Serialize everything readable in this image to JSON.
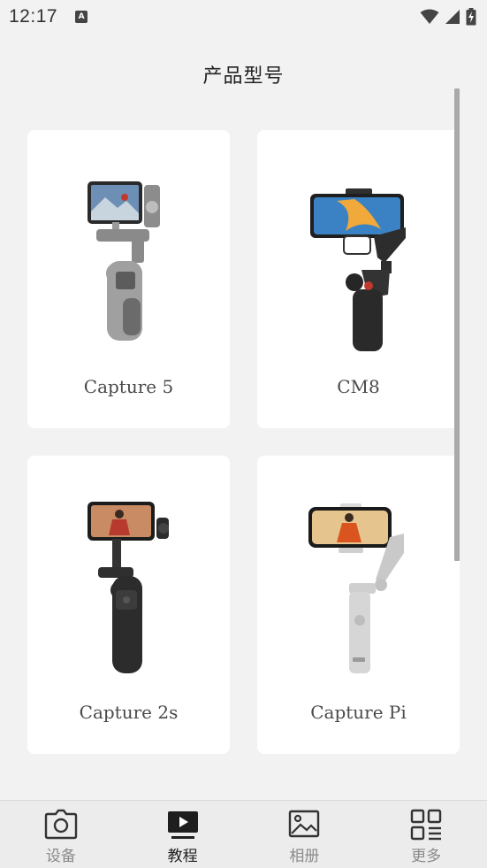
{
  "status_bar": {
    "time": "12:17",
    "notification_letter": "A"
  },
  "header": {
    "title": "产品型号"
  },
  "products": [
    {
      "name": "Capture 5",
      "image": "gimbal-grey-phone-landscape"
    },
    {
      "name": "CM8",
      "image": "gimbal-black-foldable"
    },
    {
      "name": "Capture 2s",
      "image": "gimbal-black-phone-landscape"
    },
    {
      "name": "Capture Pi",
      "image": "gimbal-silver-foldable"
    }
  ],
  "bottom_nav": {
    "active": "教程",
    "items": [
      {
        "label": "设备",
        "icon": "camera-icon"
      },
      {
        "label": "教程",
        "icon": "play-icon"
      },
      {
        "label": "相册",
        "icon": "image-icon"
      },
      {
        "label": "更多",
        "icon": "grid-icon"
      }
    ]
  },
  "colors": {
    "background": "#f2f2f2",
    "card": "#ffffff",
    "active_nav": "#222222",
    "inactive_nav": "#8a8a8a"
  }
}
